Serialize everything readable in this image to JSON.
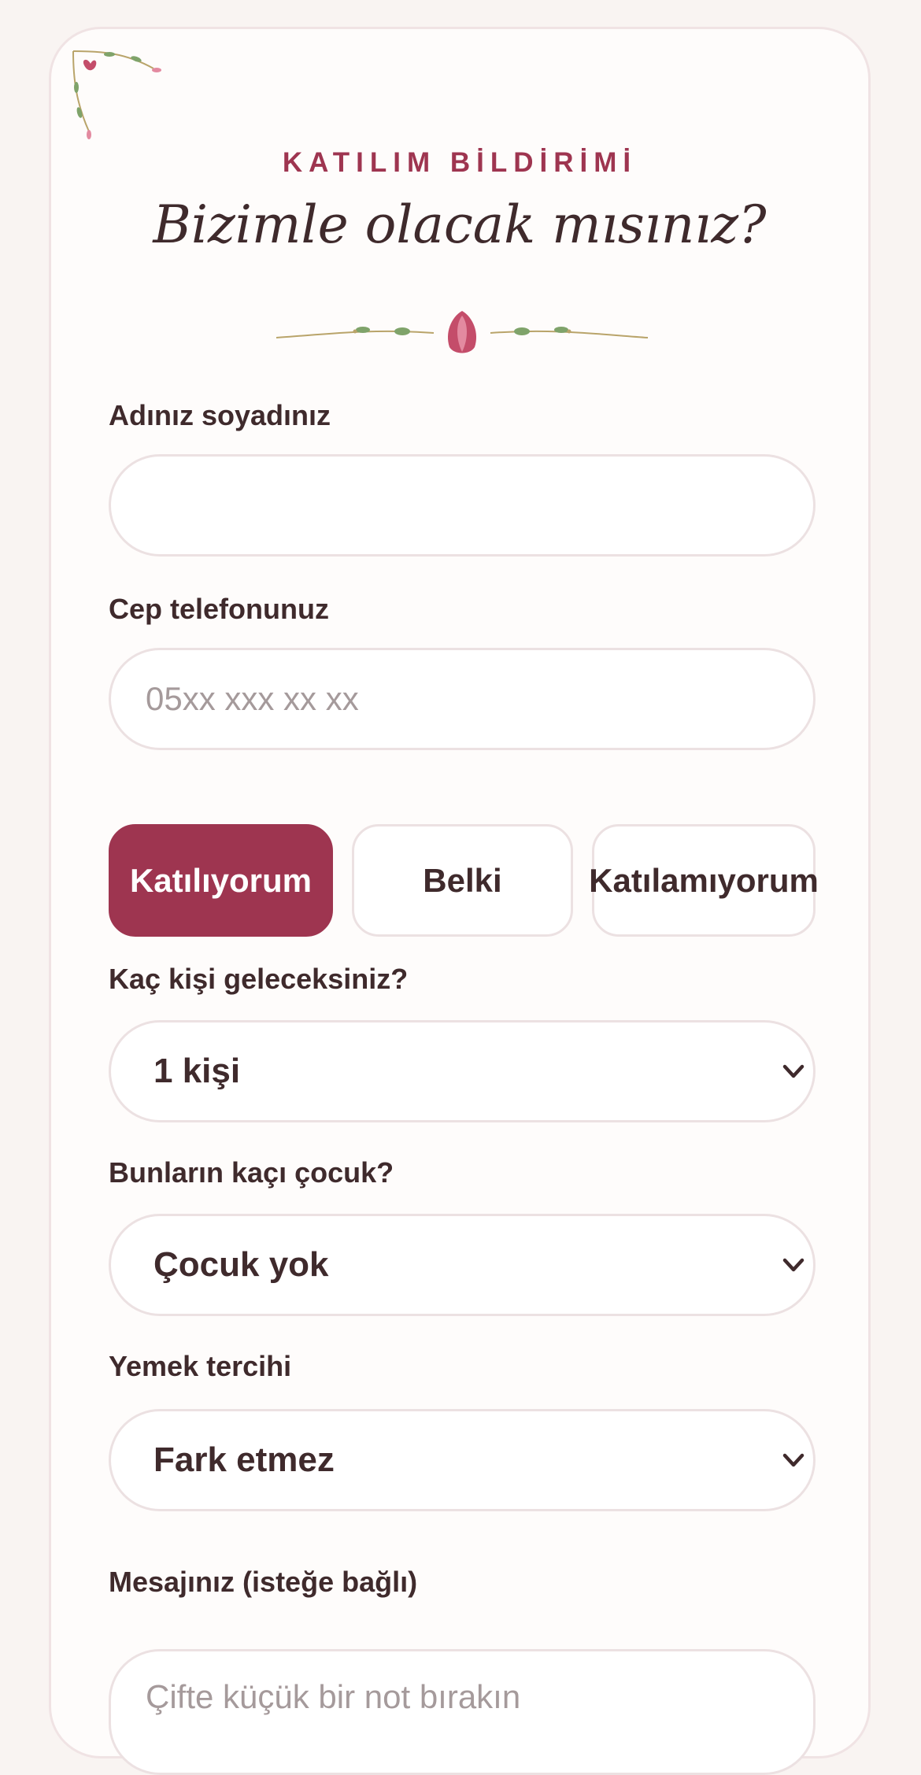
{
  "header": {
    "eyebrow": "KATILIM BİLDİRİMİ",
    "title": "Bizimle olacak mısınız?"
  },
  "form": {
    "name_label": "Adınız soyadınız",
    "name_value": "",
    "phone_label": "Cep telefonunuz",
    "phone_placeholder": "05xx xxx xx xx",
    "attendance_options": [
      "Katılıyorum",
      "Belki",
      "Katılamıyorum"
    ],
    "attendance_selected": "Katılıyorum",
    "guests_label": "Kaç kişi geleceksiniz?",
    "guests_value": "1 kişi",
    "children_label": "Bunların kaçı çocuk?",
    "children_value": "Çocuk yok",
    "meal_label": "Yemek tercihi",
    "meal_value": "Fark etmez",
    "message_label": "Mesajınız (isteğe bağlı)",
    "message_placeholder": "Çifte küçük bir not bırakın"
  },
  "colors": {
    "accent": "#9e3550",
    "text": "#3f2a2c",
    "card_bg": "#fefcfb",
    "page_bg": "#f9f4f2",
    "border": "#ece1e2",
    "placeholder": "#a59a9b",
    "leaf": "#7fa36a",
    "stem": "#b9a46a"
  },
  "icons": {
    "corner": "floral-corner-icon",
    "divider": "tulip-divider-icon",
    "select_arrow": "chevron-down-icon"
  }
}
